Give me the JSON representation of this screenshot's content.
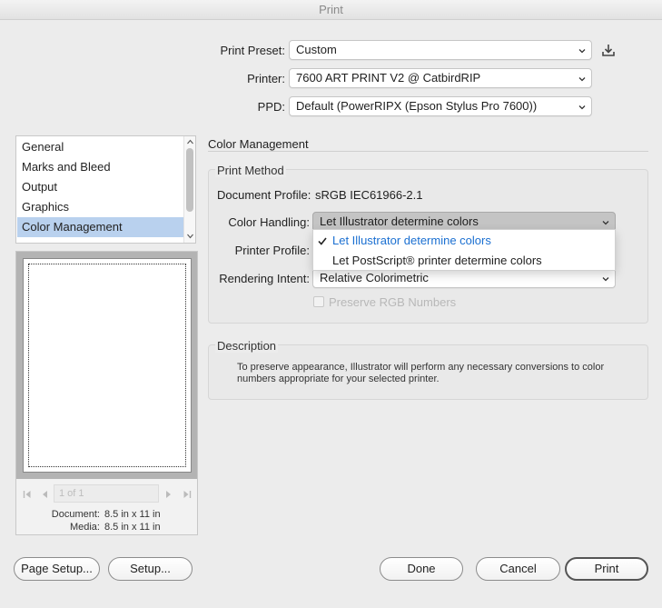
{
  "window": {
    "title": "Print"
  },
  "header": {
    "print_preset": {
      "label": "Print Preset:",
      "value": "Custom"
    },
    "printer": {
      "label": "Printer:",
      "value": "7600 ART PRINT V2 @ CatbirdRIP"
    },
    "ppd": {
      "label": "PPD:",
      "value": "Default (PowerRIPX (Epson Stylus Pro 7600))"
    }
  },
  "sidebar": {
    "items": [
      {
        "label": "General"
      },
      {
        "label": "Marks and Bleed"
      },
      {
        "label": "Output"
      },
      {
        "label": "Graphics"
      },
      {
        "label": "Color Management"
      }
    ],
    "selected_index": 4
  },
  "preview": {
    "page_field": "1 of 1",
    "document_label": "Document:",
    "document_value": "8.5 in x 11 in",
    "media_label": "Media:",
    "media_value": "8.5 in x 11 in"
  },
  "section": {
    "title": "Color Management",
    "print_method": {
      "title": "Print Method",
      "document_profile_label": "Document Profile:",
      "document_profile_value": "sRGB IEC61966-2.1",
      "color_handling_label": "Color Handling:",
      "color_handling_value": "Let Illustrator determine colors",
      "color_handling_options": [
        "Let Illustrator determine colors",
        "Let PostScript® printer determine colors"
      ],
      "printer_profile_label": "Printer Profile:",
      "rendering_intent_label": "Rendering Intent:",
      "rendering_intent_value": "Relative Colorimetric",
      "preserve_rgb_label": "Preserve RGB Numbers"
    },
    "description": {
      "title": "Description",
      "line1": "To preserve appearance, Illustrator will perform any necessary conversions to color",
      "line2": "numbers appropriate for your selected printer."
    }
  },
  "footer": {
    "page_setup": "Page Setup...",
    "setup": "Setup...",
    "done": "Done",
    "cancel": "Cancel",
    "print": "Print"
  },
  "colors": {
    "accent": "#1a6fd1",
    "selection": "#b9d1ee"
  }
}
